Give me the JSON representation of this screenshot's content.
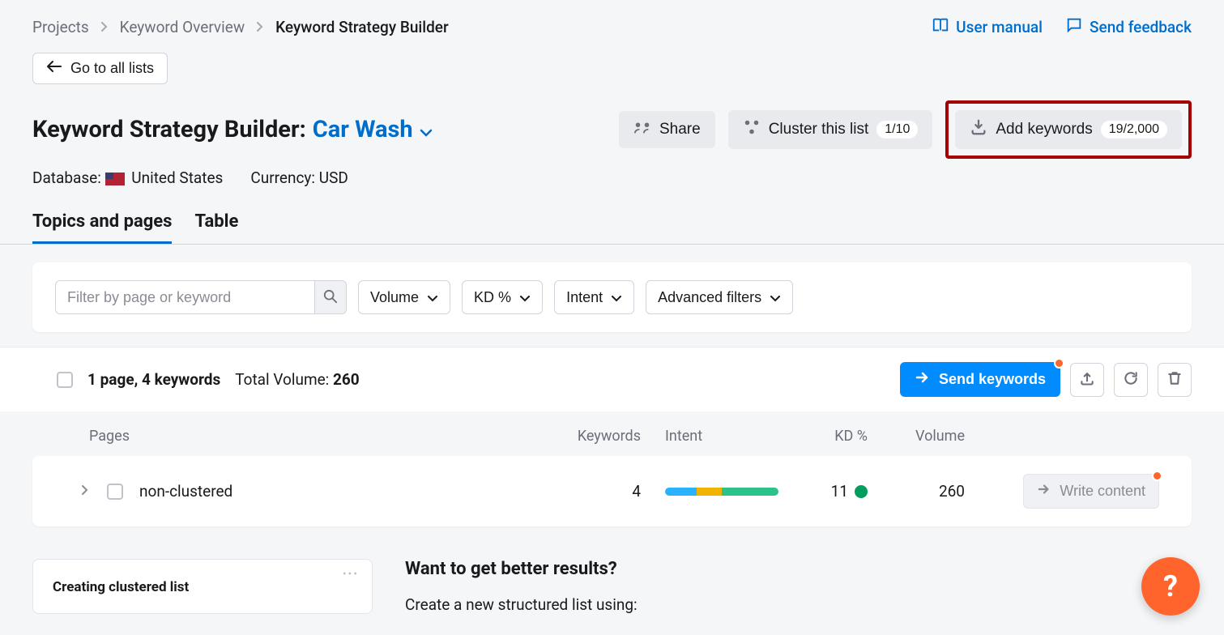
{
  "breadcrumb": {
    "items": [
      "Projects",
      "Keyword Overview",
      "Keyword Strategy Builder"
    ]
  },
  "toplinks": {
    "manual": "User manual",
    "feedback": "Send feedback"
  },
  "back_button": "Go to all lists",
  "title": {
    "prefix": "Keyword Strategy Builder:",
    "list_name": "Car Wash"
  },
  "actions": {
    "share": "Share",
    "cluster": "Cluster this list",
    "cluster_badge": "1/10",
    "add": "Add keywords",
    "add_badge": "19/2,000"
  },
  "meta": {
    "database_label": "Database:",
    "database_value": "United States",
    "currency_label": "Currency:",
    "currency_value": "USD"
  },
  "tabs": {
    "topics": "Topics and pages",
    "table": "Table"
  },
  "filters": {
    "search_placeholder": "Filter by page or keyword",
    "volume": "Volume",
    "kd": "KD %",
    "intent": "Intent",
    "advanced": "Advanced filters"
  },
  "summary": {
    "pages_keywords": "1 page, 4 keywords",
    "total_volume_label": "Total Volume: ",
    "total_volume_value": "260",
    "send": "Send keywords"
  },
  "columns": {
    "pages": "Pages",
    "keywords": "Keywords",
    "intent": "Intent",
    "kd": "KD %",
    "volume": "Volume"
  },
  "rows": [
    {
      "name": "non-clustered",
      "keywords": "4",
      "kd": "11",
      "volume": "260",
      "write": "Write content"
    }
  ],
  "promo": {
    "card_title": "Creating clustered list",
    "heading": "Want to get better results?",
    "sub": "Create a new structured list using:"
  },
  "fab": "?"
}
